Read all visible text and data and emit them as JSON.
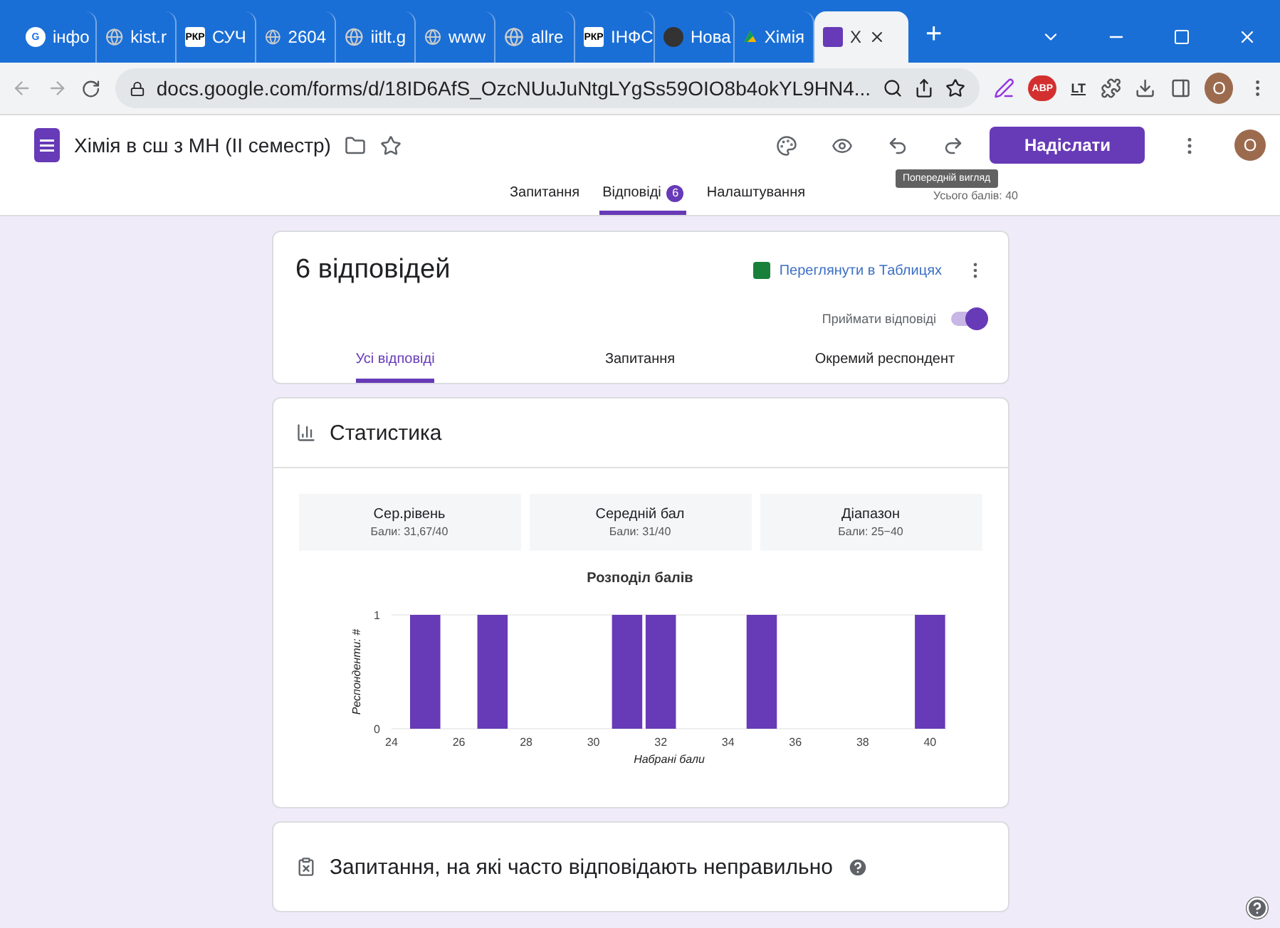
{
  "browser": {
    "tabs": [
      {
        "label": "інфо",
        "kind": "google",
        "badge": "G",
        "selected": false
      },
      {
        "label": "kist.r",
        "kind": "globe",
        "selected": false
      },
      {
        "label": "СУЧ",
        "kind": "pkp",
        "badge": "РКР",
        "selected": false
      },
      {
        "label": "2604",
        "kind": "globe",
        "selected": false
      },
      {
        "label": "iitlt.g",
        "kind": "globe",
        "selected": false
      },
      {
        "label": "www",
        "kind": "globe",
        "selected": false
      },
      {
        "label": "allre",
        "kind": "globe",
        "selected": false
      },
      {
        "label": "ІНФС",
        "kind": "pkp",
        "badge": "РКР",
        "selected": false
      },
      {
        "label": "Нова",
        "kind": "chrome",
        "selected": false
      },
      {
        "label": "Хімія",
        "kind": "drive",
        "selected": false
      },
      {
        "label": "Х",
        "kind": "forms",
        "selected": true
      }
    ],
    "new_tab": "+",
    "url": "docs.google.com/forms/d/18ID6AfS_OzcNUuJuNtgLYgSs59OIO8b4okYL9HN4...",
    "extensions": [
      {
        "kind": "pen"
      },
      {
        "kind": "abp",
        "text": "ABP"
      },
      {
        "kind": "lt",
        "text": "LT"
      },
      {
        "kind": "puzzle"
      },
      {
        "kind": "download"
      },
      {
        "kind": "panel"
      }
    ],
    "profile": "O"
  },
  "form": {
    "title": "Хімія в сш з МН (ІІ семестр)",
    "send": "Надіслати",
    "avatar": "O",
    "tooltip": "Попередній вигляд",
    "tabs": [
      {
        "label": "Запитання",
        "selected": false
      },
      {
        "label": "Відповіді",
        "badge": "6",
        "selected": true
      },
      {
        "label": "Налаштування",
        "selected": false
      }
    ],
    "total": "Усього балів: 40"
  },
  "summary": {
    "title": "6 відповідей",
    "sheets_link": "Переглянути в Таблицях",
    "accepting_label": "Приймати відповіді",
    "accepting": true,
    "tabs": [
      {
        "label": "Усі відповіді",
        "selected": true
      },
      {
        "label": "Запитання",
        "selected": false
      },
      {
        "label": "Окремий респондент",
        "selected": false
      }
    ]
  },
  "statistics": {
    "title": "Статистика",
    "cards": [
      {
        "title": "Сер.рівень",
        "value": "Бали: 31,67/40"
      },
      {
        "title": "Середній бал",
        "value": "Бали: 31/40"
      },
      {
        "title": "Діапазон",
        "value": "Бали: 25−40"
      }
    ],
    "chart_data": {
      "type": "bar",
      "title": "Розподіл балів",
      "xlabel": "Набрані бали",
      "ylabel": "Респонденти: #",
      "x": [
        25,
        27,
        31,
        32,
        35,
        40
      ],
      "values": [
        1,
        1,
        1,
        1,
        1,
        1
      ],
      "xlim": [
        24,
        40.5
      ],
      "ylim": [
        0,
        1
      ],
      "xticks": [
        24,
        26,
        28,
        30,
        32,
        34,
        36,
        38,
        40
      ],
      "yticks": [
        0,
        1
      ]
    }
  },
  "frequent_wrong": {
    "title": "Запитання, на які часто відповідають неправильно"
  }
}
